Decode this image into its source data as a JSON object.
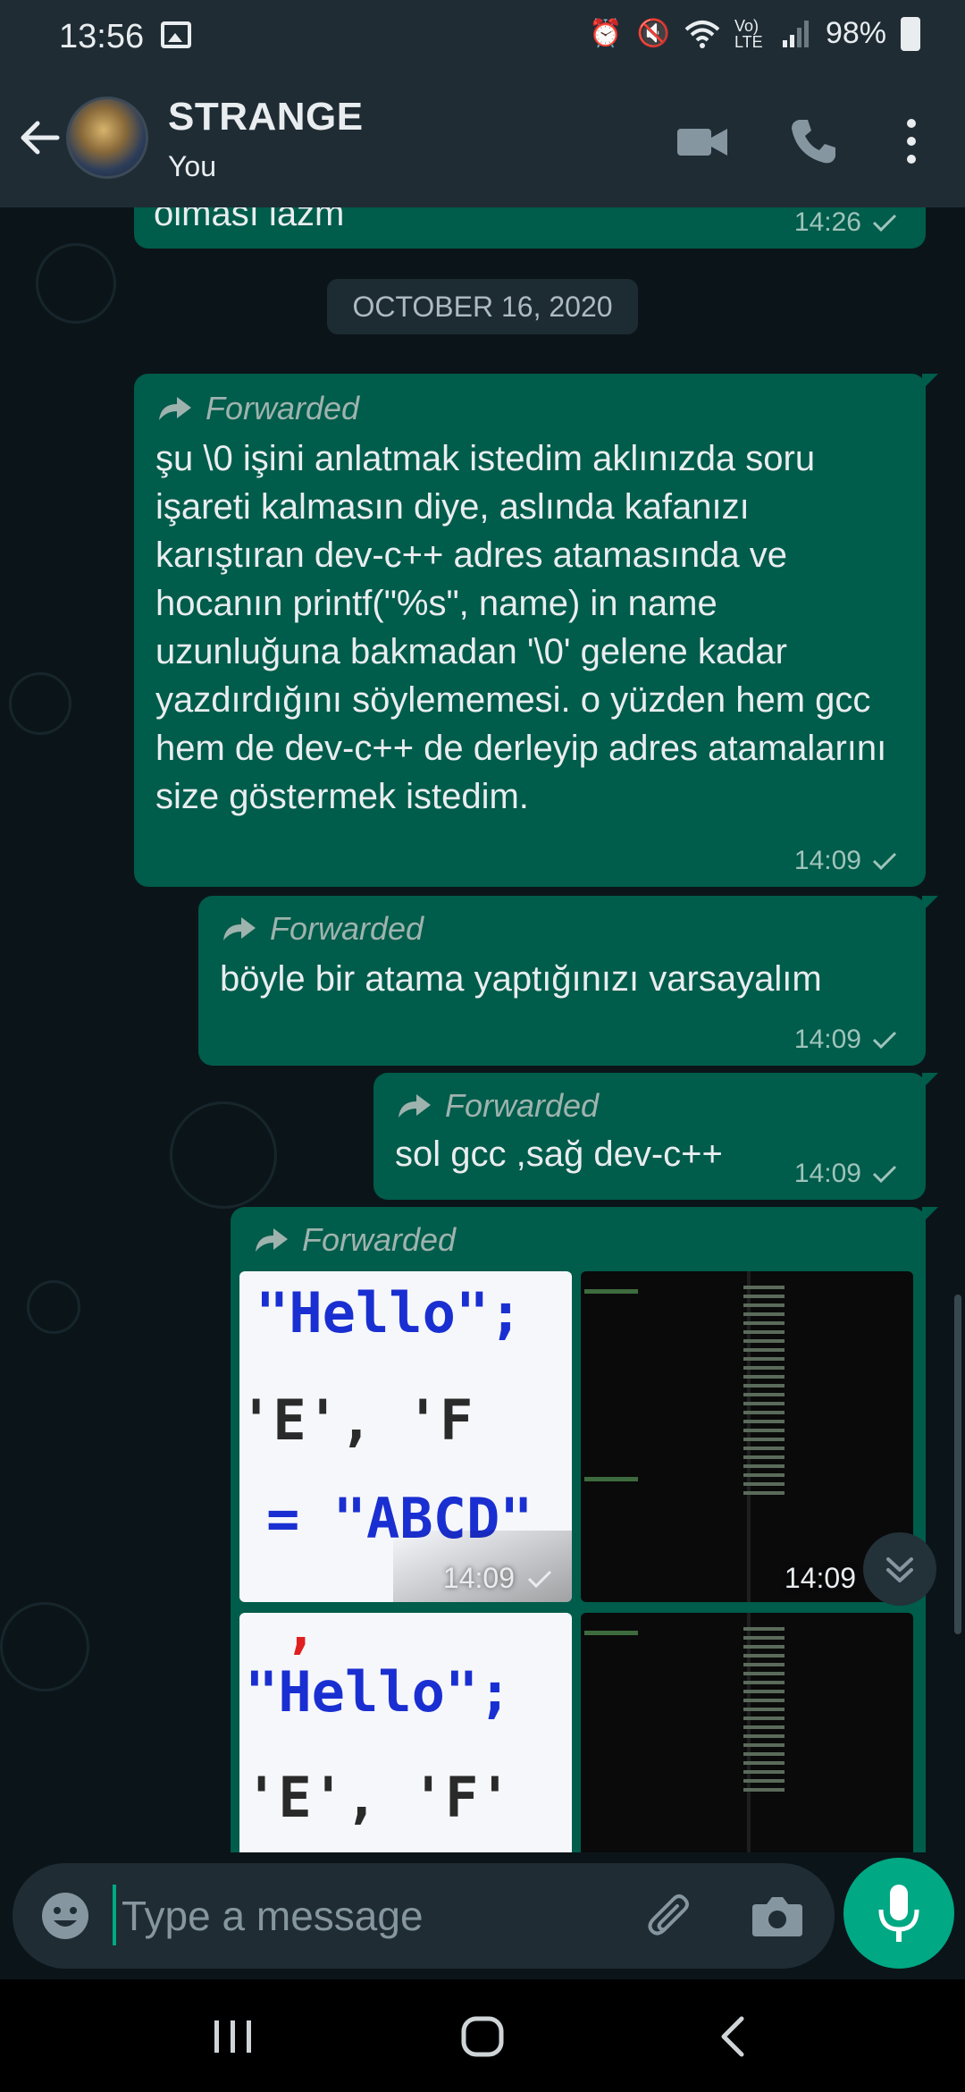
{
  "status_bar": {
    "time": "13:56",
    "battery": "98%",
    "network": "Vo) LTE"
  },
  "header": {
    "title": "STRANGE",
    "subtitle": "You"
  },
  "chat": {
    "partial_message": {
      "text": "olması lazm",
      "time": "14:26"
    },
    "date_label": "OCTOBER 16, 2020",
    "messages": [
      {
        "forwarded_label": "Forwarded",
        "text": "şu \\0 işini anlatmak istedim aklınızda soru işareti kalmasın diye, aslında kafanızı karıştıran dev-c++ adres atamasında ve hocanın printf(\"%s\", name) in name uzunluğuna bakmadan '\\0' gelene kadar yazdırdığını söylememesi. o yüzden hem gcc hem de dev-c++ de derleyip adres atamalarını size göstermek istedim.",
        "time": "14:09"
      },
      {
        "forwarded_label": "Forwarded",
        "text": "böyle bir atama yaptığınızı varsayalım",
        "time": "14:09"
      },
      {
        "forwarded_label": "Forwarded",
        "text": "sol gcc ,sağ dev-c++",
        "time": "14:09"
      }
    ],
    "media_message": {
      "forwarded_label": "Forwarded",
      "images": [
        {
          "kind": "code",
          "lines": [
            "\"Hello\";",
            "'E', 'F",
            "= \"ABCD\""
          ],
          "time": "14:09"
        },
        {
          "kind": "terminal",
          "time": "14:09"
        },
        {
          "kind": "code",
          "lines": [
            ",",
            "\"Hello\";",
            "'E', 'F'"
          ]
        },
        {
          "kind": "terminal"
        }
      ]
    }
  },
  "input": {
    "placeholder": "Type a message"
  },
  "colors": {
    "outgoing_bubble": "#005c4b",
    "accent": "#00a884",
    "header": "#1f2c34",
    "background": "#0b1519"
  },
  "icons": [
    "back-arrow-icon",
    "video-call-icon",
    "phone-icon",
    "more-menu-icon",
    "forward-arrow-icon",
    "double-check-icon",
    "emoji-icon",
    "attach-icon",
    "camera-icon",
    "mic-icon",
    "scroll-down-icon"
  ]
}
